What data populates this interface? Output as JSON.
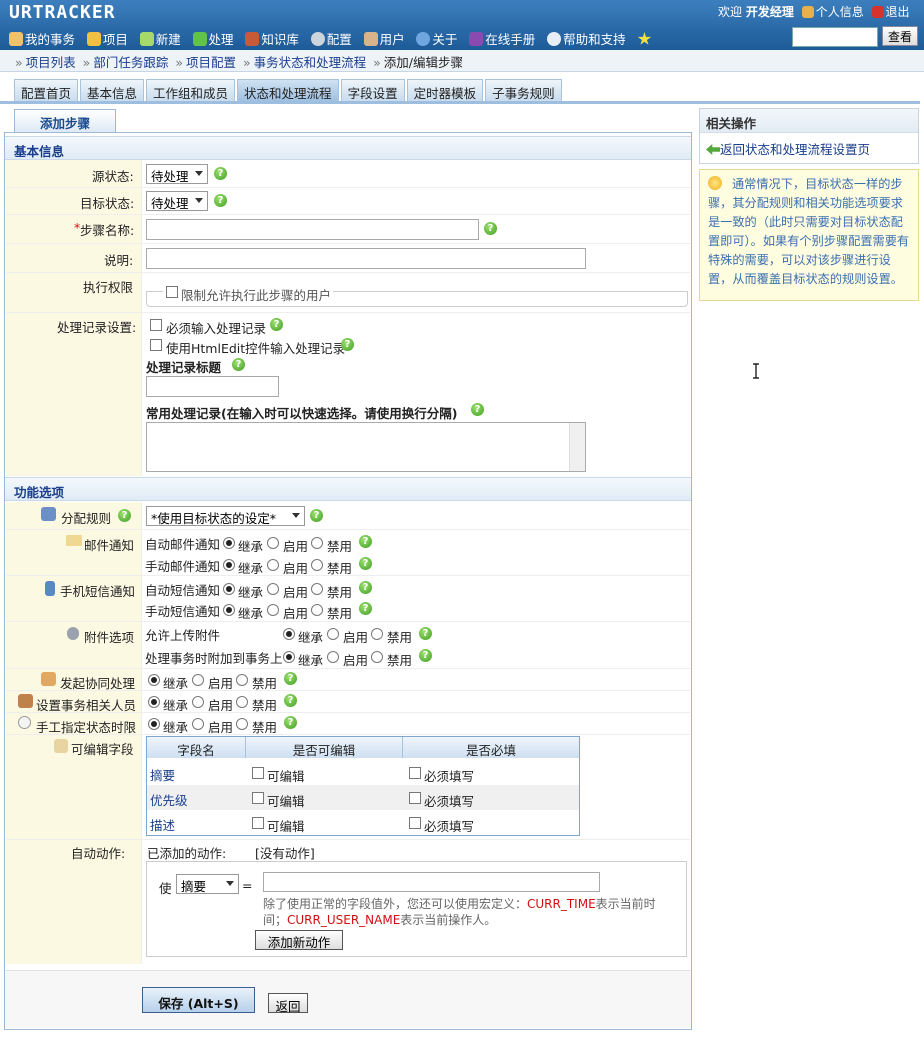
{
  "header": {
    "logo": "URTRACKER",
    "welcome_prefix": "欢迎",
    "user_name": "开发经理",
    "profile_link": "个人信息",
    "logout_link": "退出",
    "nav": [
      {
        "label": "我的事务",
        "icon": "home-icon"
      },
      {
        "label": "项目",
        "icon": "database-icon"
      },
      {
        "label": "新建",
        "icon": "new-icon"
      },
      {
        "label": "处理",
        "icon": "check-icon"
      },
      {
        "label": "知识库",
        "icon": "books-icon"
      },
      {
        "label": "配置",
        "icon": "gear-icon"
      },
      {
        "label": "用户",
        "icon": "users-icon"
      },
      {
        "label": "关于",
        "icon": "info-icon"
      },
      {
        "label": "在线手册",
        "icon": "manual-icon"
      },
      {
        "label": "帮助和支持",
        "icon": "help-icon"
      }
    ],
    "search_button": "查看"
  },
  "breadcrumb": [
    "项目列表",
    "部门任务跟踪",
    "项目配置",
    "事务状态和处理流程",
    "添加/编辑步骤"
  ],
  "tabs": [
    "配置首页",
    "基本信息",
    "工作组和成员",
    "状态和处理流程",
    "字段设置",
    "定时器模板",
    "子事务规则"
  ],
  "active_tab": "状态和处理流程",
  "subtab": "添加步骤",
  "basic": {
    "section_title": "基本信息",
    "source_label": "源状态:",
    "source_value": "待处理",
    "target_label": "目标状态:",
    "target_value": "待处理",
    "required_mark": "*",
    "step_name_label": "步骤名称:",
    "desc_label": "说明:",
    "perm_label": "执行权限",
    "perm_checkbox": "限制允许执行此步骤的用户",
    "record_label": "处理记录设置:",
    "must_input": "必须输入处理记录",
    "use_html": "使用HtmlEdit控件输入处理记录",
    "record_title_label": "处理记录标题",
    "common_records_label": "常用处理记录(在输入时可以快速选择。请使用换行分隔)"
  },
  "func": {
    "section_title": "功能选项",
    "assign_label": "分配规则",
    "assign_value": "*使用目标状态的设定*",
    "mail_label": "邮件通知",
    "auto_mail": "自动邮件通知",
    "manual_mail": "手动邮件通知",
    "sms_label": "手机短信通知",
    "auto_sms": "自动短信通知",
    "manual_sms": "手动短信通知",
    "attach_label": "附件选项",
    "allow_upload": "允许上传附件",
    "attach_to_issue": "处理事务时附加到事务上",
    "collab_label": "发起协同处理",
    "related_label": "设置事务相关人员",
    "deadline_label": "手工指定状态时限",
    "opt_inherit": "继承",
    "opt_enable": "启用",
    "opt_disable": "禁用",
    "editable_label": "可编辑字段",
    "table_headers": [
      "字段名",
      "是否可编辑",
      "是否必填"
    ],
    "fields": [
      {
        "name": "摘要",
        "editable": "可编辑",
        "required": "必须填写"
      },
      {
        "name": "优先级",
        "editable": "可编辑",
        "required": "必须填写"
      },
      {
        "name": "描述",
        "editable": "可编辑",
        "required": "必须填写"
      }
    ],
    "auto_action_label": "自动动作:",
    "added_actions_label": "已添加的动作:",
    "no_action": "[没有动作]",
    "make_label": "使",
    "field_select": "摘要",
    "equals": "=",
    "macro_text_1": "除了使用正常的字段值外，您还可以使用宏定义：",
    "macro_curr_time": "CURR_TIME",
    "macro_text_2": "表示当前时",
    "macro_text_3": "间；",
    "macro_curr_user": "CURR_USER_NAME",
    "macro_text_4": "表示当前操作人。",
    "add_action_button": "添加新动作"
  },
  "buttons": {
    "save": "保存 (Alt+S)",
    "back": "返回"
  },
  "right": {
    "panel_title": "相关操作",
    "return_link": "返回状态和处理流程设置页",
    "tip": "通常情况下，目标状态一样的步骤，其分配规则和相关功能选项要求是一致的（此时只需要对目标状态配置即可）。如果有个别步骤配置需要有特殊的需要，可以对该步骤进行设置，从而覆盖目标状态的规则设置。"
  },
  "colors": {
    "header_blue": "#1d5a98",
    "link_blue": "#1a3e8c",
    "macro_red": "#d01010",
    "help_green": "#3d9e21",
    "label_bg": "#fcf9e3"
  }
}
